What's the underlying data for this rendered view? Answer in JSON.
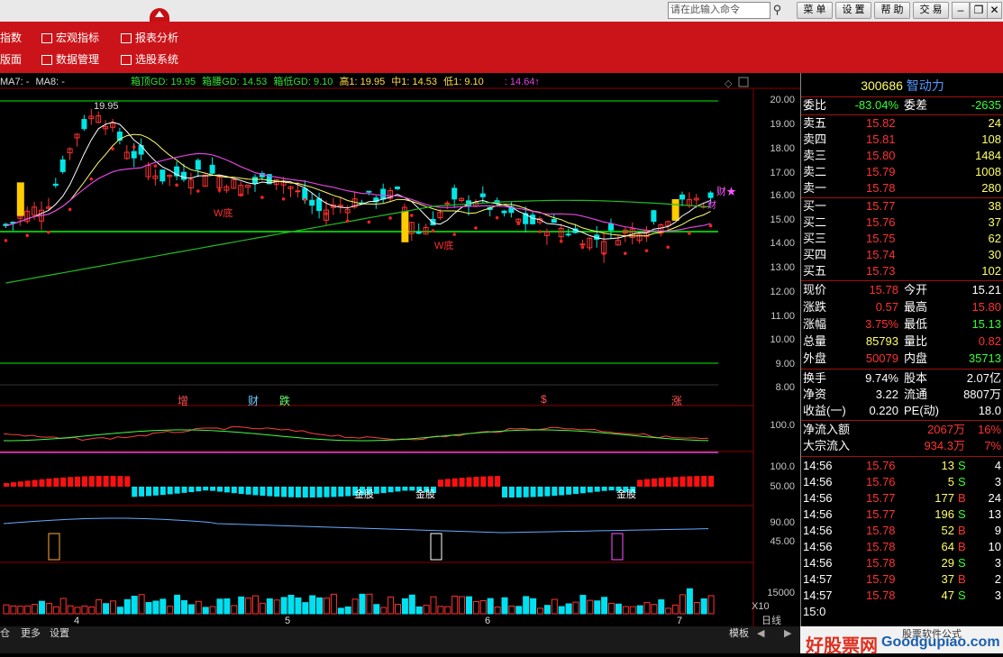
{
  "topbar": {
    "command_placeholder": "请在此输入命令",
    "buttons": [
      "菜 单",
      "设 置",
      "帮 助",
      "交 易"
    ],
    "window_controls": [
      "minimize",
      "restore",
      "close"
    ]
  },
  "menu": {
    "items": [
      {
        "label": "指数"
      },
      {
        "label": "宏观指标"
      },
      {
        "label": "报表分析"
      },
      {
        "label": "版面"
      },
      {
        "label": "数据管理"
      },
      {
        "label": "选股系统"
      }
    ]
  },
  "legend": {
    "ma7": "MA7: -",
    "ma8": "MA8: -",
    "box_top": "箱顶GD: 19.95",
    "box_mid": "箱腰GD: 14.53",
    "box_low": "箱低GD: 9.10",
    "high": "高1: 19.95",
    "mid": "中1: 14.53",
    "low": "低1: 9.10",
    "last": ": 14.64↑"
  },
  "chart": {
    "y_axis_main": [
      "20.00",
      "19.00",
      "18.00",
      "17.00",
      "16.00",
      "15.00",
      "14.00",
      "13.00",
      "12.00",
      "11.00",
      "10.00",
      "9.00",
      "8.00"
    ],
    "y_axis_ind1": [
      "100.0"
    ],
    "y_axis_ind2": [
      "100.0",
      "50.00"
    ],
    "y_axis_ind3": [
      "90.00",
      "45.00"
    ],
    "y_axis_vol": [
      "15000"
    ],
    "vol_scale": "X10",
    "x_labels": [
      "4",
      "5",
      "6",
      "7"
    ],
    "period": "日线",
    "peak_label": "19.95",
    "annotations": {
      "w_bottom_1": "W底",
      "w_bottom_2": "W底",
      "cai_star": "财★",
      "cai_small": "财",
      "zeng": "增",
      "cai": "财",
      "die": "跌",
      "dollar": "$",
      "zhang": "涨",
      "jingu_1": "金股",
      "jingu_2": "金股",
      "jingu_3": "金股"
    },
    "colors": {
      "up": "#ff3232",
      "down": "#00e6e6",
      "ma_white": "#ffffff",
      "ma_yellow": "#ffff66",
      "ma_magenta": "#dd44dd",
      "ma_green": "#22bb22",
      "box_line": "#00ff00"
    }
  },
  "quote": {
    "code": "300686",
    "name": "智动力",
    "weibi_label": "委比",
    "weibi": "-83.04%",
    "weicha_label": "委差",
    "weicha": "-2635",
    "asks": [
      {
        "label": "卖五",
        "price": "15.82",
        "vol": "24"
      },
      {
        "label": "卖四",
        "price": "15.81",
        "vol": "108"
      },
      {
        "label": "卖三",
        "price": "15.80",
        "vol": "1484"
      },
      {
        "label": "卖二",
        "price": "15.79",
        "vol": "1008"
      },
      {
        "label": "卖一",
        "price": "15.78",
        "vol": "280"
      }
    ],
    "bids": [
      {
        "label": "买一",
        "price": "15.77",
        "vol": "38"
      },
      {
        "label": "买二",
        "price": "15.76",
        "vol": "37"
      },
      {
        "label": "买三",
        "price": "15.75",
        "vol": "62"
      },
      {
        "label": "买四",
        "price": "15.74",
        "vol": "30"
      },
      {
        "label": "买五",
        "price": "15.73",
        "vol": "102"
      }
    ],
    "stats": [
      {
        "l1": "现价",
        "v1": "15.78",
        "l2": "今开",
        "v2": "15.21"
      },
      {
        "l1": "涨跌",
        "v1": "0.57",
        "l2": "最高",
        "v2": "15.80"
      },
      {
        "l1": "涨幅",
        "v1": "3.75%",
        "l2": "最低",
        "v2": "15.13"
      },
      {
        "l1": "总量",
        "v1": "85793",
        "l2": "量比",
        "v2": "0.82"
      },
      {
        "l1": "外盘",
        "v1": "50079",
        "l2": "内盘",
        "v2": "35713"
      }
    ],
    "fund": [
      {
        "l1": "换手",
        "v1": "9.74%",
        "l2": "股本",
        "v2": "2.07亿"
      },
      {
        "l1": "净资",
        "v1": "3.22",
        "l2": "流通",
        "v2": "8807万"
      },
      {
        "l1": "收益(一)",
        "v1": "0.220",
        "l2": "PE(动)",
        "v2": "18.0"
      }
    ],
    "flow": [
      {
        "label": "净流入额",
        "value": "2067万",
        "pct": "16%"
      },
      {
        "label": "大宗流入",
        "value": "934.3万",
        "pct": "7%"
      }
    ],
    "ticks": [
      {
        "time": "14:56",
        "price": "15.76",
        "vol": "13",
        "side": "S",
        "n": "4"
      },
      {
        "time": "14:56",
        "price": "15.76",
        "vol": "5",
        "side": "S",
        "n": "3"
      },
      {
        "time": "14:56",
        "price": "15.77",
        "vol": "177",
        "side": "B",
        "n": "24"
      },
      {
        "time": "14:56",
        "price": "15.77",
        "vol": "196",
        "side": "S",
        "n": "13"
      },
      {
        "time": "14:56",
        "price": "15.78",
        "vol": "52",
        "side": "B",
        "n": "9"
      },
      {
        "time": "14:56",
        "price": "15.78",
        "vol": "64",
        "side": "B",
        "n": "10"
      },
      {
        "time": "14:56",
        "price": "15.78",
        "vol": "29",
        "side": "S",
        "n": "3"
      },
      {
        "time": "14:57",
        "price": "15.79",
        "vol": "37",
        "side": "B",
        "n": "2"
      },
      {
        "time": "14:57",
        "price": "15.78",
        "vol": "47",
        "side": "S",
        "n": "3"
      },
      {
        "time": "15:0",
        "price": "",
        "vol": "",
        "side": "",
        "n": ""
      }
    ]
  },
  "bottom": {
    "tabs": [
      "仓",
      "更多",
      "设置"
    ],
    "template": "模板"
  },
  "watermark": {
    "brand_cn": "好股票网",
    "brand_en": "Goodgupiao.com",
    "caption": "股票软件公式"
  }
}
